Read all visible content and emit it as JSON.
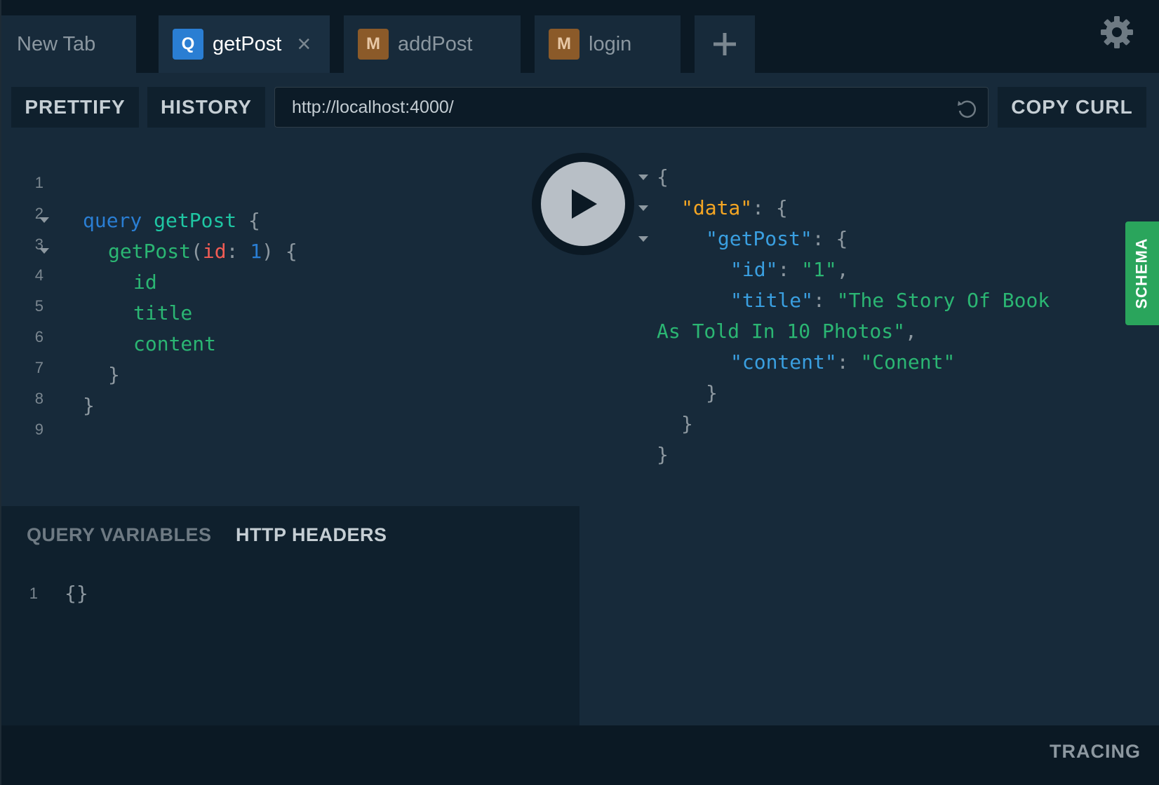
{
  "tabs": [
    {
      "label": "New Tab",
      "badge": "",
      "active": false
    },
    {
      "label": "getPost",
      "badge": "Q",
      "active": true
    },
    {
      "label": "addPost",
      "badge": "M",
      "active": false
    },
    {
      "label": "login",
      "badge": "M",
      "active": false
    }
  ],
  "tab_close_glyph": "×",
  "toolbar": {
    "prettify": "PRETTIFY",
    "history": "HISTORY",
    "url": "http://localhost:4000/",
    "copy_curl": "COPY CURL"
  },
  "query_editor": {
    "line_numbers": [
      "1",
      "2",
      "3",
      "4",
      "5",
      "6",
      "7",
      "8",
      "9"
    ],
    "tokens": {
      "query_kw": "query",
      "op_name": "getPost",
      "brace_open": "{",
      "field_getpost": "getPost",
      "paren_open": "(",
      "arg_id": "id",
      "colon": ":",
      "arg_value": "1",
      "paren_close": ")",
      "field_id": "id",
      "field_title": "title",
      "field_content": "content",
      "brace_close": "}"
    }
  },
  "variables_panel": {
    "tab_query_variables": "QUERY VARIABLES",
    "tab_http_headers": "HTTP HEADERS",
    "line_number": "1",
    "value": "{}"
  },
  "result": {
    "brace_open": "{",
    "brace_close": "}",
    "key_data": "\"data\"",
    "key_getpost": "\"getPost\"",
    "key_id": "\"id\"",
    "val_id": "\"1\"",
    "key_title": "\"title\"",
    "val_title_part1": "\"The Story Of Book",
    "val_title_part2": "As Told In 10 Photos\"",
    "key_content": "\"content\"",
    "val_content": "\"Conent\"",
    "colon": ":",
    "comma": ","
  },
  "schema_tab": "SCHEMA",
  "footer": {
    "tracing": "TRACING"
  },
  "colors": {
    "background": "#0b1924",
    "panel": "#172a3a",
    "query_badge": "#2a7ed3",
    "mutation_badge": "#8b5a29",
    "schema_tab": "#2aa55c",
    "string": "#2bb673",
    "keyword": "#2a7ed3",
    "argument": "#f25c54",
    "data_key": "#f5a623"
  },
  "icons": {
    "settings": "gear-icon",
    "add_tab": "plus-icon",
    "reload": "reload-icon",
    "run": "play-icon"
  }
}
